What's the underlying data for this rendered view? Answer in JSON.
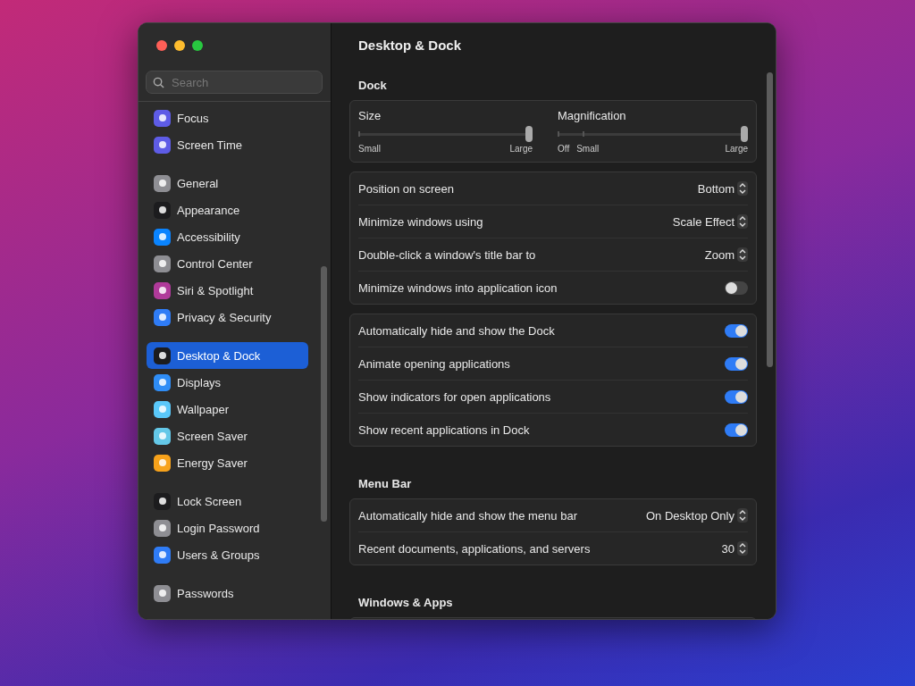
{
  "window": {
    "title": "Desktop & Dock"
  },
  "search": {
    "placeholder": "Search"
  },
  "sidebar": {
    "groups": [
      {
        "items": [
          {
            "label": "Focus",
            "color": "#5e5ce6",
            "selected": false
          },
          {
            "label": "Screen Time",
            "color": "#5e5ce6",
            "selected": false
          }
        ]
      },
      {
        "items": [
          {
            "label": "General",
            "color": "#8e8e93",
            "selected": false
          },
          {
            "label": "Appearance",
            "color": "#1c1c1e",
            "selected": false
          },
          {
            "label": "Accessibility",
            "color": "#0a84ff",
            "selected": false
          },
          {
            "label": "Control Center",
            "color": "#8e8e93",
            "selected": false
          },
          {
            "label": "Siri & Spotlight",
            "color": "#b03a9a",
            "selected": false
          },
          {
            "label": "Privacy & Security",
            "color": "#2f7cf6",
            "selected": false
          }
        ]
      },
      {
        "items": [
          {
            "label": "Desktop & Dock",
            "color": "#1c1c1e",
            "selected": true
          },
          {
            "label": "Displays",
            "color": "#2f8df6",
            "selected": false
          },
          {
            "label": "Wallpaper",
            "color": "#5ac8fa",
            "selected": false
          },
          {
            "label": "Screen Saver",
            "color": "#64c8e8",
            "selected": false
          },
          {
            "label": "Energy Saver",
            "color": "#f7a21b",
            "selected": false
          }
        ]
      },
      {
        "items": [
          {
            "label": "Lock Screen",
            "color": "#1c1c1e",
            "selected": false
          },
          {
            "label": "Login Password",
            "color": "#8e8e93",
            "selected": false
          },
          {
            "label": "Users & Groups",
            "color": "#2f7cf6",
            "selected": false
          }
        ]
      },
      {
        "items": [
          {
            "label": "Passwords",
            "color": "#8e8e93",
            "selected": false
          }
        ]
      }
    ]
  },
  "sections": [
    {
      "title": "Dock",
      "cards": [
        {
          "kind": "sliders",
          "sliders": [
            {
              "label": "Size",
              "level": 1.0,
              "min_label": "Small",
              "max_label": "Large"
            },
            {
              "label": "Magnification",
              "level": 1.0,
              "min_label": "Off",
              "mid_label": "Small",
              "max_label": "Large"
            }
          ]
        },
        {
          "kind": "rows",
          "rows": [
            {
              "kind": "popup",
              "label": "Position on screen",
              "value": "Bottom"
            },
            {
              "kind": "popup",
              "label": "Minimize windows using",
              "value": "Scale Effect"
            },
            {
              "kind": "popup",
              "label": "Double-click a window's title bar to",
              "value": "Zoom"
            },
            {
              "kind": "toggle",
              "label": "Minimize windows into application icon",
              "on": false
            }
          ]
        },
        {
          "kind": "rows",
          "rows": [
            {
              "kind": "toggle",
              "label": "Automatically hide and show the Dock",
              "on": true
            },
            {
              "kind": "toggle",
              "label": "Animate opening applications",
              "on": true
            },
            {
              "kind": "toggle",
              "label": "Show indicators for open applications",
              "on": true
            },
            {
              "kind": "toggle",
              "label": "Show recent applications in Dock",
              "on": true
            }
          ]
        }
      ]
    },
    {
      "title": "Menu Bar",
      "cards": [
        {
          "kind": "rows",
          "rows": [
            {
              "kind": "popup",
              "label": "Automatically hide and show the menu bar",
              "value": "On Desktop Only"
            },
            {
              "kind": "popup",
              "label": "Recent documents, applications, and servers",
              "value": "30"
            }
          ]
        }
      ]
    },
    {
      "title": "Windows & Apps",
      "cards": [
        {
          "kind": "rows"
        }
      ]
    }
  ]
}
